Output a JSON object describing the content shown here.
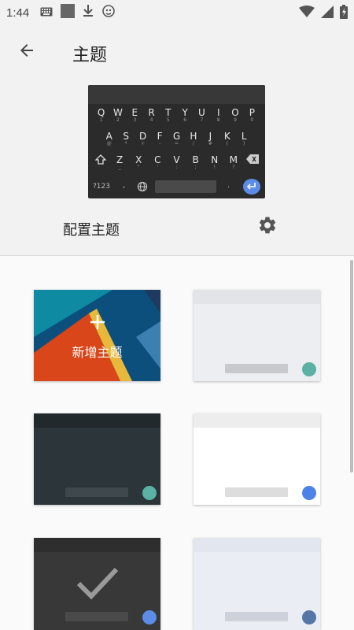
{
  "status_bar": {
    "time": "1:44",
    "left_icons": [
      "keyboard-icon",
      "square-notification-icon",
      "download-icon",
      "android-debug-icon"
    ],
    "right_icons": [
      "wifi-icon",
      "signal-icon",
      "battery-charging-icon"
    ]
  },
  "header": {
    "title": "主题",
    "back_icon": "arrow-back-icon"
  },
  "keyboard_preview": {
    "row1": [
      "Q",
      "W",
      "E",
      "R",
      "T",
      "Y",
      "U",
      "I",
      "O",
      "P"
    ],
    "row1_hints": [
      "1",
      "2",
      "3",
      "4",
      "5",
      "6",
      "7",
      "8",
      "9",
      "0"
    ],
    "row2": [
      "A",
      "S",
      "D",
      "F",
      "G",
      "H",
      "J",
      "K",
      "L"
    ],
    "row2_hints": [
      "@",
      "*",
      "+",
      "-",
      "=",
      "/",
      "#",
      "(",
      ")"
    ],
    "row3": [
      "Z",
      "X",
      "C",
      "V",
      "B",
      "N",
      "M"
    ],
    "row3_hints": [
      "_",
      "\"",
      "'",
      ":",
      ";",
      "!",
      "?"
    ],
    "symbols_label": "?123",
    "comma": ",",
    "period": "."
  },
  "config": {
    "label": "配置主题",
    "gear_icon": "gear-icon"
  },
  "themes": {
    "add_label": "新增主题",
    "cards": [
      {
        "name": "add-theme",
        "bg": "#0e7c9a"
      },
      {
        "name": "light-gray-teal",
        "bar": "#e2e4e7",
        "body": "#eceef1",
        "pill": "#c7c9cc",
        "dot": "#5bb1a4"
      },
      {
        "name": "dark-slate-teal",
        "bar": "#22292d",
        "body": "#2b353a",
        "pill": "#3e484d",
        "dot": "#5bb1a4"
      },
      {
        "name": "white-blue",
        "bar": "#ededed",
        "body": "#ffffff",
        "pill": "#dddddd",
        "dot": "#4d82e8"
      },
      {
        "name": "dark-selected",
        "bar": "#2e2e2e",
        "body": "#383838",
        "pill": "#4a4a4a",
        "dot": "#5b8de8",
        "selected": true
      },
      {
        "name": "light-blue-gray",
        "bar": "#e2e6ee",
        "body": "#eaeef4",
        "pill": "#cdd2da",
        "dot": "#5577a8"
      }
    ]
  },
  "colors": {
    "accent": "#5b8de8",
    "header_bg": "#f2f2f2",
    "page_bg": "#fafafa"
  }
}
